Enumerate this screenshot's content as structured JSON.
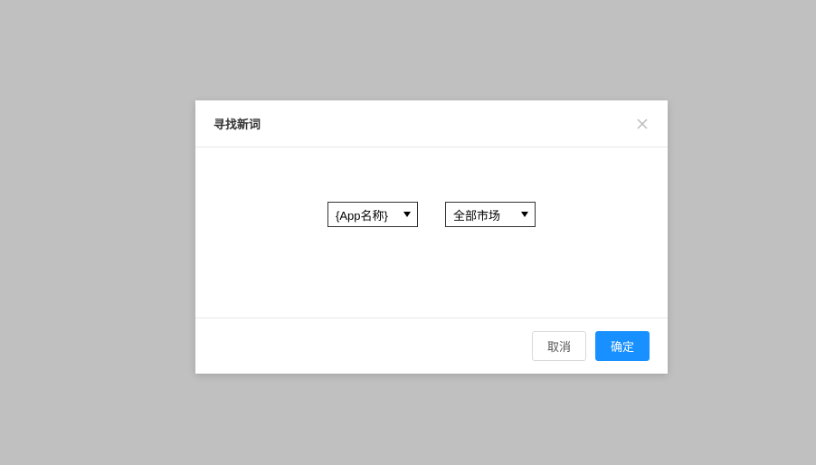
{
  "modal": {
    "title": "寻找新词",
    "select_app": {
      "value": "{App名称}"
    },
    "select_market": {
      "value": "全部市场"
    },
    "footer": {
      "cancel_label": "取消",
      "confirm_label": "确定"
    }
  }
}
